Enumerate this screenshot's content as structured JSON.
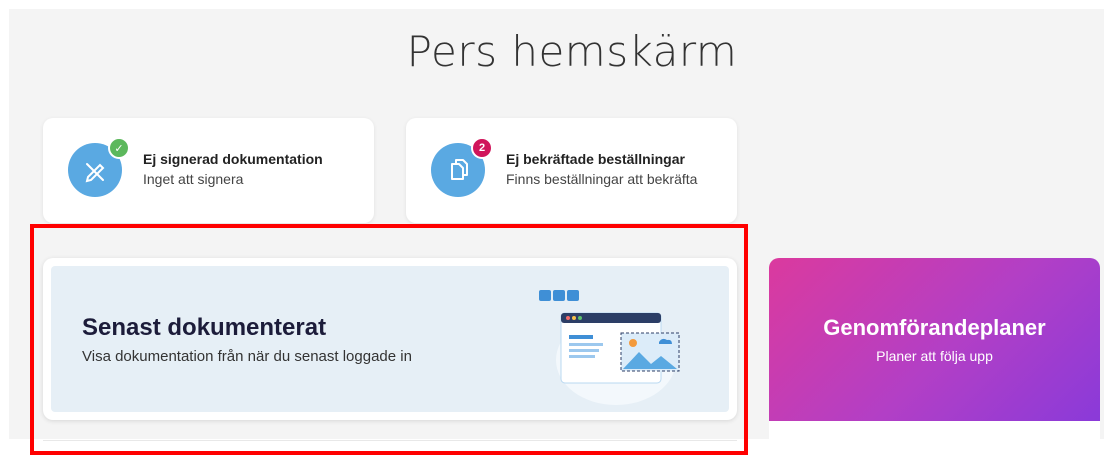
{
  "page": {
    "title": "Pers hemskärm"
  },
  "cards": {
    "unsigned": {
      "title": "Ej signerad dokumentation",
      "subtitle": "Inget att signera",
      "icon": "pen-crossed-icon",
      "badge_icon": "check-icon",
      "badge_color": "#5cb85c"
    },
    "orders": {
      "title": "Ej bekräftade beställningar",
      "subtitle": "Finns beställningar att bekräfta",
      "icon": "documents-icon",
      "badge_count": "2",
      "badge_color": "#d0155b"
    }
  },
  "latest": {
    "title": "Senast dokumenterat",
    "subtitle": "Visa dokumentation från när du senast loggade in",
    "illustration": "browser-window-illustration"
  },
  "plans": {
    "title": "Genomförandeplaner",
    "subtitle": "Planer att följa upp",
    "gradient": [
      "#db3a9e",
      "#8a3ad9"
    ]
  },
  "colors": {
    "icon_circle": "#5aa9e2",
    "highlight": "#ff0000",
    "latest_bg": "#e6eff6"
  }
}
